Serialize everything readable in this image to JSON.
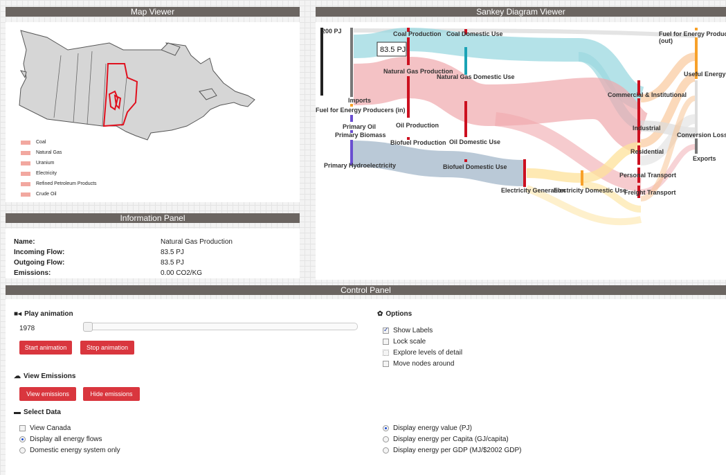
{
  "panels": {
    "map_title": "Map Viewer",
    "sankey_title": "Sankey Diagram Viewer",
    "info_title": "Information Panel",
    "control_title": "Control Panel"
  },
  "map": {
    "legend": [
      "Coal",
      "Natural Gas",
      "Uranium",
      "Electricity",
      "Refined Petroleum Products",
      "Crude Oil"
    ],
    "legend_color": "#f2a8a0",
    "highlight_color": "#e0101e"
  },
  "info": {
    "name_label": "Name:",
    "name_value": "Natural Gas Production",
    "incoming_label": "Incoming Flow:",
    "incoming_value": "83.5 PJ",
    "outgoing_label": "Outgoing Flow:",
    "outgoing_value": "83.5 PJ",
    "emissions_label": "Emissions:",
    "emissions_value": "0.00 CO2/KG"
  },
  "sankey": {
    "scale_label": "200 PJ",
    "tooltip": "83.5 PJ",
    "nodes": {
      "coal_production": "Coal Production",
      "coal_domestic": "Coal Domestic Use",
      "fuel_out": "Fuel for Energy Producers",
      "fuel_out_2": "(out)",
      "natural_gas_production": "Natural Gas Production",
      "natural_gas_domestic": "Natural Gas Domestic Use",
      "useful_energy": "Useful Energy",
      "imports": "Imports",
      "fuel_in": "Fuel for Energy Producers (in)",
      "commercial": "Commercial & Institutional",
      "primary_oil": "Primary Oil",
      "oil_production": "Oil Production",
      "primary_biomass": "Primary Biomass",
      "industrial": "Industrial",
      "conversion_loss": "Conversion Loss",
      "biofuel_production": "Biofuel Production",
      "oil_domestic": "Oil Domestic Use",
      "residential": "Residential",
      "exports": "Exports",
      "primary_hydro": "Primary Hydroelectricity",
      "biofuel_domestic": "Biofuel Domestic Use",
      "personal_transport": "Personal Transport",
      "electricity_generation": "Electricity Generation",
      "electricity_domestic": "Electricity Domestic Use",
      "freight_transport": "Freight Transport"
    },
    "colors": {
      "gas": "#9bd8e0",
      "oil": "#f0a8ad",
      "hydro": "#a9bccd",
      "electricity": "#fde29a",
      "coal": "#cfcfcf",
      "useful": "#f8bf8c",
      "node_red": "#cc1020",
      "node_teal": "#1aa3b5",
      "node_purple": "#6a4fd0",
      "node_orange": "#f7a12a"
    }
  },
  "controls": {
    "play_title": "Play animation",
    "year": "1978",
    "start_label": "Start animation",
    "stop_label": "Stop animation",
    "options_title": "Options",
    "options": [
      {
        "label": "Show Labels",
        "checked": true
      },
      {
        "label": "Lock scale",
        "checked": false
      },
      {
        "label": "Explore levels of detail",
        "checked": false
      },
      {
        "label": "Move nodes around",
        "checked": false
      }
    ],
    "emissions_title": "View Emissions",
    "view_emissions_label": "View emissions",
    "hide_emissions_label": "Hide emissions",
    "select_title": "Select Data",
    "view_canada": "View Canada",
    "flows": [
      {
        "label": "Display all energy flows",
        "selected": true
      },
      {
        "label": "Domestic energy system only",
        "selected": false
      }
    ],
    "display": [
      {
        "label": "Display energy value (PJ)",
        "selected": true
      },
      {
        "label": "Display energy per Capita (GJ/capita)",
        "selected": false
      },
      {
        "label": "Display energy per GDP (MJ/$2002 GDP)",
        "selected": false
      }
    ],
    "button_color": "#d9363e"
  }
}
